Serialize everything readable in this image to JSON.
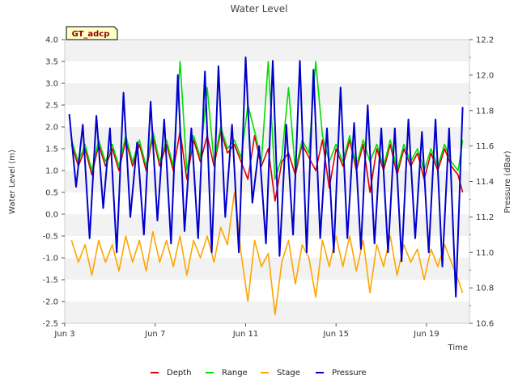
{
  "chart_data": {
    "type": "line",
    "title": "Water Level",
    "xlabel": "Time",
    "ylabel": "Water Level (m)",
    "y2label": "Pressure (dBar)",
    "site_label": "GT_adcp",
    "x_ticks": [
      "Jun 3",
      "Jun 7",
      "Jun 11",
      "Jun 15",
      "Jun 19"
    ],
    "x_tick_days": [
      3,
      7,
      11,
      15,
      19
    ],
    "xlim_days": [
      3,
      20.9
    ],
    "y_ticks": [
      "4.0",
      "3.5",
      "3.0",
      "2.5",
      "2.0",
      "1.5",
      "1.0",
      "0.5",
      "0.0",
      "-0.5",
      "-1.0",
      "-1.5",
      "-2.0",
      "-2.5"
    ],
    "ylim": [
      -2.5,
      4.0
    ],
    "y2_ticks": [
      "12.2",
      "12.0",
      "11.8",
      "11.6",
      "11.4",
      "11.2",
      "11.0",
      "10.8",
      "10.6"
    ],
    "y2lim": [
      10.6,
      12.2
    ],
    "grid": "horizontal bands",
    "legend_position": "bottom",
    "series": [
      {
        "name": "Depth",
        "color": "#dd0000",
        "axis": "left",
        "x": [
          3.3,
          3.6,
          3.9,
          4.2,
          4.5,
          4.8,
          5.1,
          5.4,
          5.7,
          6.0,
          6.3,
          6.6,
          6.9,
          7.2,
          7.5,
          7.8,
          8.1,
          8.4,
          8.7,
          9.0,
          9.3,
          9.6,
          9.9,
          10.2,
          10.5,
          10.8,
          11.1,
          11.4,
          11.7,
          12.0,
          12.3,
          12.6,
          12.9,
          13.2,
          13.5,
          13.8,
          14.1,
          14.4,
          14.7,
          15.0,
          15.3,
          15.6,
          15.9,
          16.2,
          16.5,
          16.8,
          17.1,
          17.4,
          17.7,
          18.0,
          18.3,
          18.6,
          18.9,
          19.2,
          19.5,
          19.8,
          20.1,
          20.4,
          20.6
        ],
        "y": [
          1.6,
          1.1,
          1.5,
          0.9,
          1.6,
          1.1,
          1.5,
          1.0,
          1.7,
          1.1,
          1.6,
          1.0,
          1.8,
          1.1,
          1.6,
          1.0,
          1.9,
          0.8,
          1.7,
          1.2,
          1.8,
          1.1,
          1.9,
          1.4,
          1.6,
          1.2,
          0.8,
          1.8,
          1.1,
          1.5,
          0.3,
          1.2,
          1.4,
          0.9,
          1.6,
          1.3,
          1.0,
          1.7,
          0.6,
          1.5,
          1.1,
          1.7,
          1.0,
          1.6,
          0.5,
          1.5,
          1.0,
          1.6,
          0.9,
          1.5,
          1.1,
          1.4,
          0.8,
          1.4,
          1.0,
          1.5,
          1.1,
          0.9,
          0.5
        ]
      },
      {
        "name": "Range",
        "color": "#00dd00",
        "axis": "left",
        "x": [
          3.3,
          3.6,
          3.9,
          4.2,
          4.5,
          4.8,
          5.1,
          5.4,
          5.7,
          6.0,
          6.3,
          6.6,
          6.9,
          7.2,
          7.5,
          7.8,
          8.1,
          8.4,
          8.7,
          9.0,
          9.3,
          9.6,
          9.9,
          10.2,
          10.5,
          10.8,
          11.1,
          11.4,
          11.7,
          12.0,
          12.3,
          12.6,
          12.9,
          13.2,
          13.5,
          13.8,
          14.1,
          14.4,
          14.7,
          15.0,
          15.3,
          15.6,
          15.9,
          16.2,
          16.5,
          16.8,
          17.1,
          17.4,
          17.7,
          18.0,
          18.3,
          18.6,
          18.9,
          19.2,
          19.5,
          19.8,
          20.1,
          20.4,
          20.6
        ],
        "y": [
          1.7,
          1.2,
          1.6,
          1.0,
          1.7,
          1.2,
          1.6,
          1.1,
          1.8,
          1.2,
          1.7,
          1.1,
          1.9,
          1.2,
          1.7,
          1.1,
          3.5,
          1.0,
          1.8,
          1.3,
          2.9,
          1.2,
          2.0,
          1.5,
          1.7,
          1.3,
          2.5,
          1.9,
          1.2,
          3.5,
          0.8,
          1.3,
          2.9,
          1.0,
          1.7,
          1.4,
          3.5,
          1.8,
          1.2,
          1.6,
          1.2,
          1.8,
          1.1,
          1.7,
          1.2,
          1.6,
          1.1,
          1.7,
          1.0,
          1.6,
          1.2,
          1.5,
          1.0,
          1.5,
          1.1,
          1.6,
          1.2,
          1.0,
          1.7
        ]
      },
      {
        "name": "Stage",
        "color": "#ffa500",
        "axis": "left",
        "x": [
          3.3,
          3.6,
          3.9,
          4.2,
          4.5,
          4.8,
          5.1,
          5.4,
          5.7,
          6.0,
          6.3,
          6.6,
          6.9,
          7.2,
          7.5,
          7.8,
          8.1,
          8.4,
          8.7,
          9.0,
          9.3,
          9.6,
          9.9,
          10.2,
          10.5,
          10.8,
          11.1,
          11.4,
          11.7,
          12.0,
          12.3,
          12.6,
          12.9,
          13.2,
          13.5,
          13.8,
          14.1,
          14.4,
          14.7,
          15.0,
          15.3,
          15.6,
          15.9,
          16.2,
          16.5,
          16.8,
          17.1,
          17.4,
          17.7,
          18.0,
          18.3,
          18.6,
          18.9,
          19.2,
          19.5,
          19.8,
          20.1,
          20.4,
          20.6
        ],
        "y": [
          -0.6,
          -1.1,
          -0.7,
          -1.4,
          -0.6,
          -1.1,
          -0.7,
          -1.3,
          -0.5,
          -1.1,
          -0.6,
          -1.3,
          -0.4,
          -1.1,
          -0.6,
          -1.2,
          -0.5,
          -1.4,
          -0.6,
          -1.0,
          -0.5,
          -1.1,
          -0.3,
          -0.7,
          0.5,
          -0.9,
          -2.0,
          -0.6,
          -1.2,
          -0.9,
          -2.3,
          -1.1,
          -0.6,
          -1.6,
          -0.7,
          -1.0,
          -1.9,
          -0.6,
          -1.2,
          -0.5,
          -1.2,
          -0.5,
          -1.3,
          -0.6,
          -1.8,
          -0.7,
          -1.2,
          -0.5,
          -1.4,
          -0.7,
          -1.1,
          -0.8,
          -1.5,
          -0.8,
          -1.2,
          -0.7,
          -1.1,
          -1.5,
          -1.8
        ]
      },
      {
        "name": "Pressure",
        "color": "#0000cc",
        "axis": "right",
        "x": [
          3.2,
          3.5,
          3.8,
          4.1,
          4.4,
          4.7,
          5.0,
          5.3,
          5.6,
          5.9,
          6.2,
          6.5,
          6.8,
          7.1,
          7.4,
          7.7,
          8.0,
          8.3,
          8.6,
          8.9,
          9.2,
          9.5,
          9.8,
          10.1,
          10.4,
          10.7,
          11.0,
          11.3,
          11.6,
          11.9,
          12.2,
          12.5,
          12.8,
          13.1,
          13.4,
          13.7,
          14.0,
          14.3,
          14.6,
          14.9,
          15.2,
          15.5,
          15.8,
          16.1,
          16.4,
          16.7,
          17.0,
          17.3,
          17.6,
          17.9,
          18.2,
          18.5,
          18.8,
          19.1,
          19.4,
          19.7,
          20.0,
          20.3,
          20.6
        ],
        "y": [
          11.78,
          11.37,
          11.72,
          11.08,
          11.77,
          11.25,
          11.7,
          11.0,
          11.9,
          11.2,
          11.62,
          11.1,
          11.85,
          11.18,
          11.75,
          11.05,
          12.0,
          11.12,
          11.7,
          11.08,
          12.02,
          11.0,
          12.05,
          11.2,
          11.72,
          11.0,
          12.1,
          11.28,
          11.6,
          11.05,
          12.08,
          10.98,
          11.72,
          11.1,
          12.08,
          11.0,
          12.03,
          11.08,
          11.7,
          11.0,
          11.93,
          11.08,
          11.73,
          11.02,
          11.83,
          11.05,
          11.7,
          11.0,
          11.7,
          10.95,
          11.75,
          11.08,
          11.68,
          11.0,
          11.75,
          10.92,
          11.7,
          10.75,
          11.82
        ]
      }
    ]
  }
}
